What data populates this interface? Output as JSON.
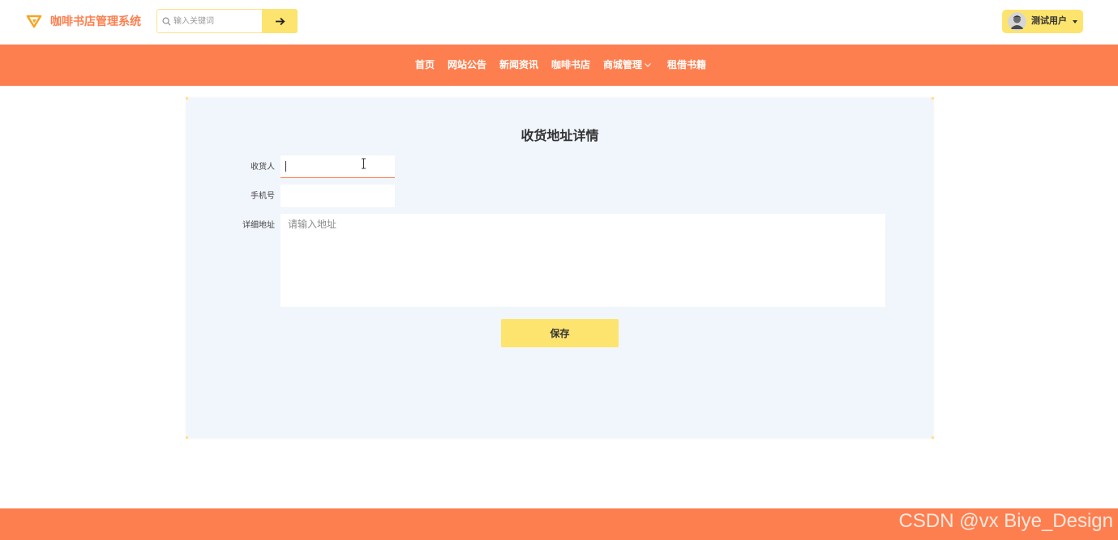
{
  "header": {
    "brand": "咖啡书店管理系统",
    "search": {
      "placeholder": "输入关键词",
      "value": ""
    },
    "search_button_icon": "arrow-right-icon",
    "user": {
      "name": "测试用户",
      "avatar_icon": "avatar-icon",
      "caret_icon": "caret-down-icon"
    }
  },
  "nav": {
    "items": [
      {
        "label": "首页"
      },
      {
        "label": "网站公告"
      },
      {
        "label": "新闻资讯"
      },
      {
        "label": "咖啡书店"
      },
      {
        "label": "商城管理",
        "icon": "chevron-down-icon"
      },
      {
        "label": "租借书籍"
      }
    ]
  },
  "form": {
    "title": "收货地址详情",
    "fields": {
      "receiver": {
        "label": "收货人",
        "value": "",
        "placeholder": ""
      },
      "phone": {
        "label": "手机号",
        "value": "",
        "placeholder": ""
      },
      "address": {
        "label": "详细地址",
        "value": "",
        "placeholder": "请输入地址"
      }
    },
    "save_label": "保存"
  },
  "footer": {
    "watermark": "CSDN @vx Biye_Design"
  },
  "colors": {
    "accent": "#fd7f4f",
    "button": "#fde46e",
    "card_bg": "#f1f5fc"
  }
}
